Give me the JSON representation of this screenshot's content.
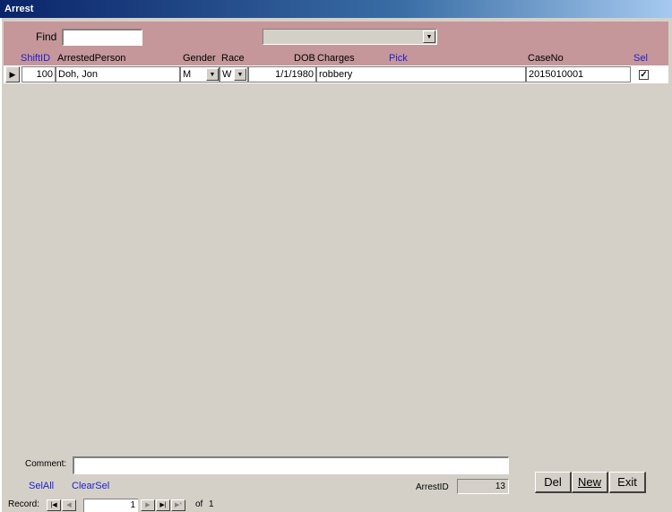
{
  "window": {
    "title": "Arrest"
  },
  "find": {
    "label": "Find",
    "value": "",
    "dropdown_value": ""
  },
  "columns": {
    "shift_id": "ShiftID",
    "arrested_person": "ArrestedPerson",
    "gender": "Gender",
    "race": "Race",
    "dob": "DOB",
    "charges": "Charges",
    "pick": "Pick",
    "case_no": "CaseNo",
    "sel": "Sel"
  },
  "rows": [
    {
      "shift_id": "100",
      "arrested_person": "Doh, Jon",
      "gender": "M",
      "race": "W",
      "dob": "1/1/1980",
      "charges": "robbery",
      "case_no": "2015010001",
      "sel": true
    }
  ],
  "footer": {
    "comment_label": "Comment:",
    "comment_value": "",
    "sel_all": "SelAll",
    "clear_sel": "ClearSel",
    "arrest_id_label": "ArrestID",
    "arrest_id_value": "13",
    "del_label": "Del",
    "new_label": "New",
    "exit_label": "Exit"
  },
  "record_nav": {
    "label": "Record:",
    "current": "1",
    "of_label": "of",
    "total": "1"
  }
}
